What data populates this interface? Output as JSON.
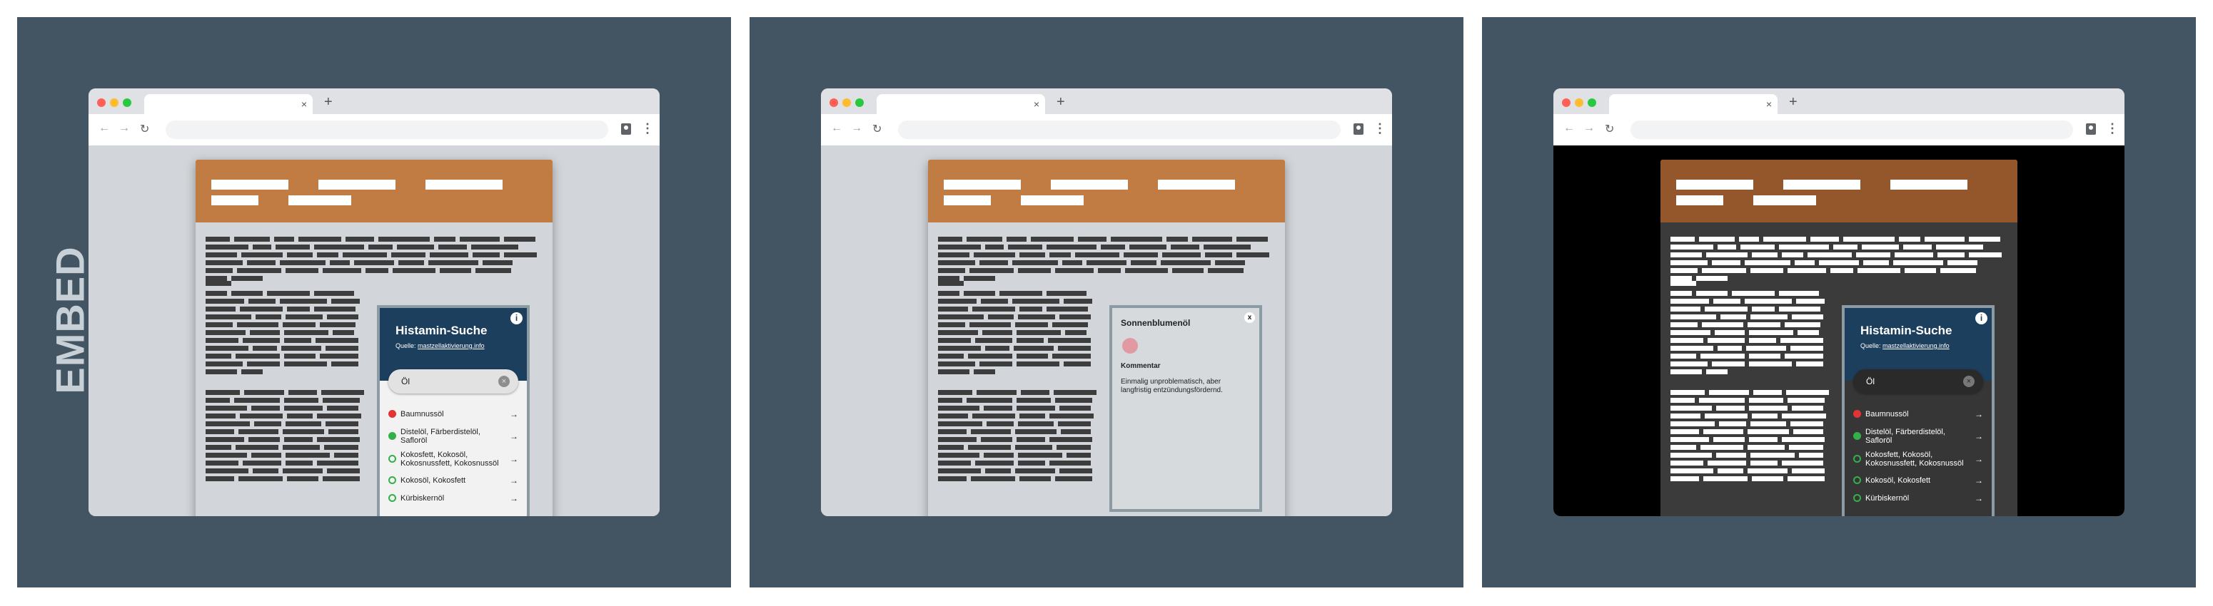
{
  "colors": {
    "background": "#435562",
    "site_header": "#c07c42",
    "site_header_dark": "#93572b",
    "widget_header": "#1d3f5e",
    "status_red": "#e23434",
    "status_green": "#34b04b",
    "detail_dot": "#e19aa2"
  },
  "side_label": "EMBED",
  "browser": {
    "tab_close": "×",
    "new_tab": "+",
    "back": "←",
    "forward": "→",
    "reload": "↻",
    "menu": "⋮"
  },
  "widget": {
    "title": "Histamin-Suche",
    "source_prefix": "Quelle:",
    "source_link": "mastzellaktivierung.info",
    "info_icon": "i",
    "search_value": "Öl",
    "clear_icon": "×",
    "results": [
      {
        "name": "Baumnussöl",
        "status": "red",
        "icon": "red-dot-icon"
      },
      {
        "name": "Distelöl, Färberdistelöl, Safloröl",
        "status": "green",
        "icon": "green-dot-icon"
      },
      {
        "name": "Kokosfett, Kokosöl, Kokosnussfett, Kokosnussöl",
        "status": "green-outline",
        "icon": "green-ring-icon"
      },
      {
        "name": "Kokosöl, Kokosfett",
        "status": "green-outline",
        "icon": "green-ring-icon"
      },
      {
        "name": "Kürbiskernöl",
        "status": "green-outline",
        "icon": "green-ring-icon"
      }
    ],
    "arrow": "→"
  },
  "detail": {
    "name": "Sonnenblumenöl",
    "close": "x",
    "heading": "Kommentar",
    "comment": "Einmalig unproblematisch, aber langfristig entzündungsfördernd."
  }
}
